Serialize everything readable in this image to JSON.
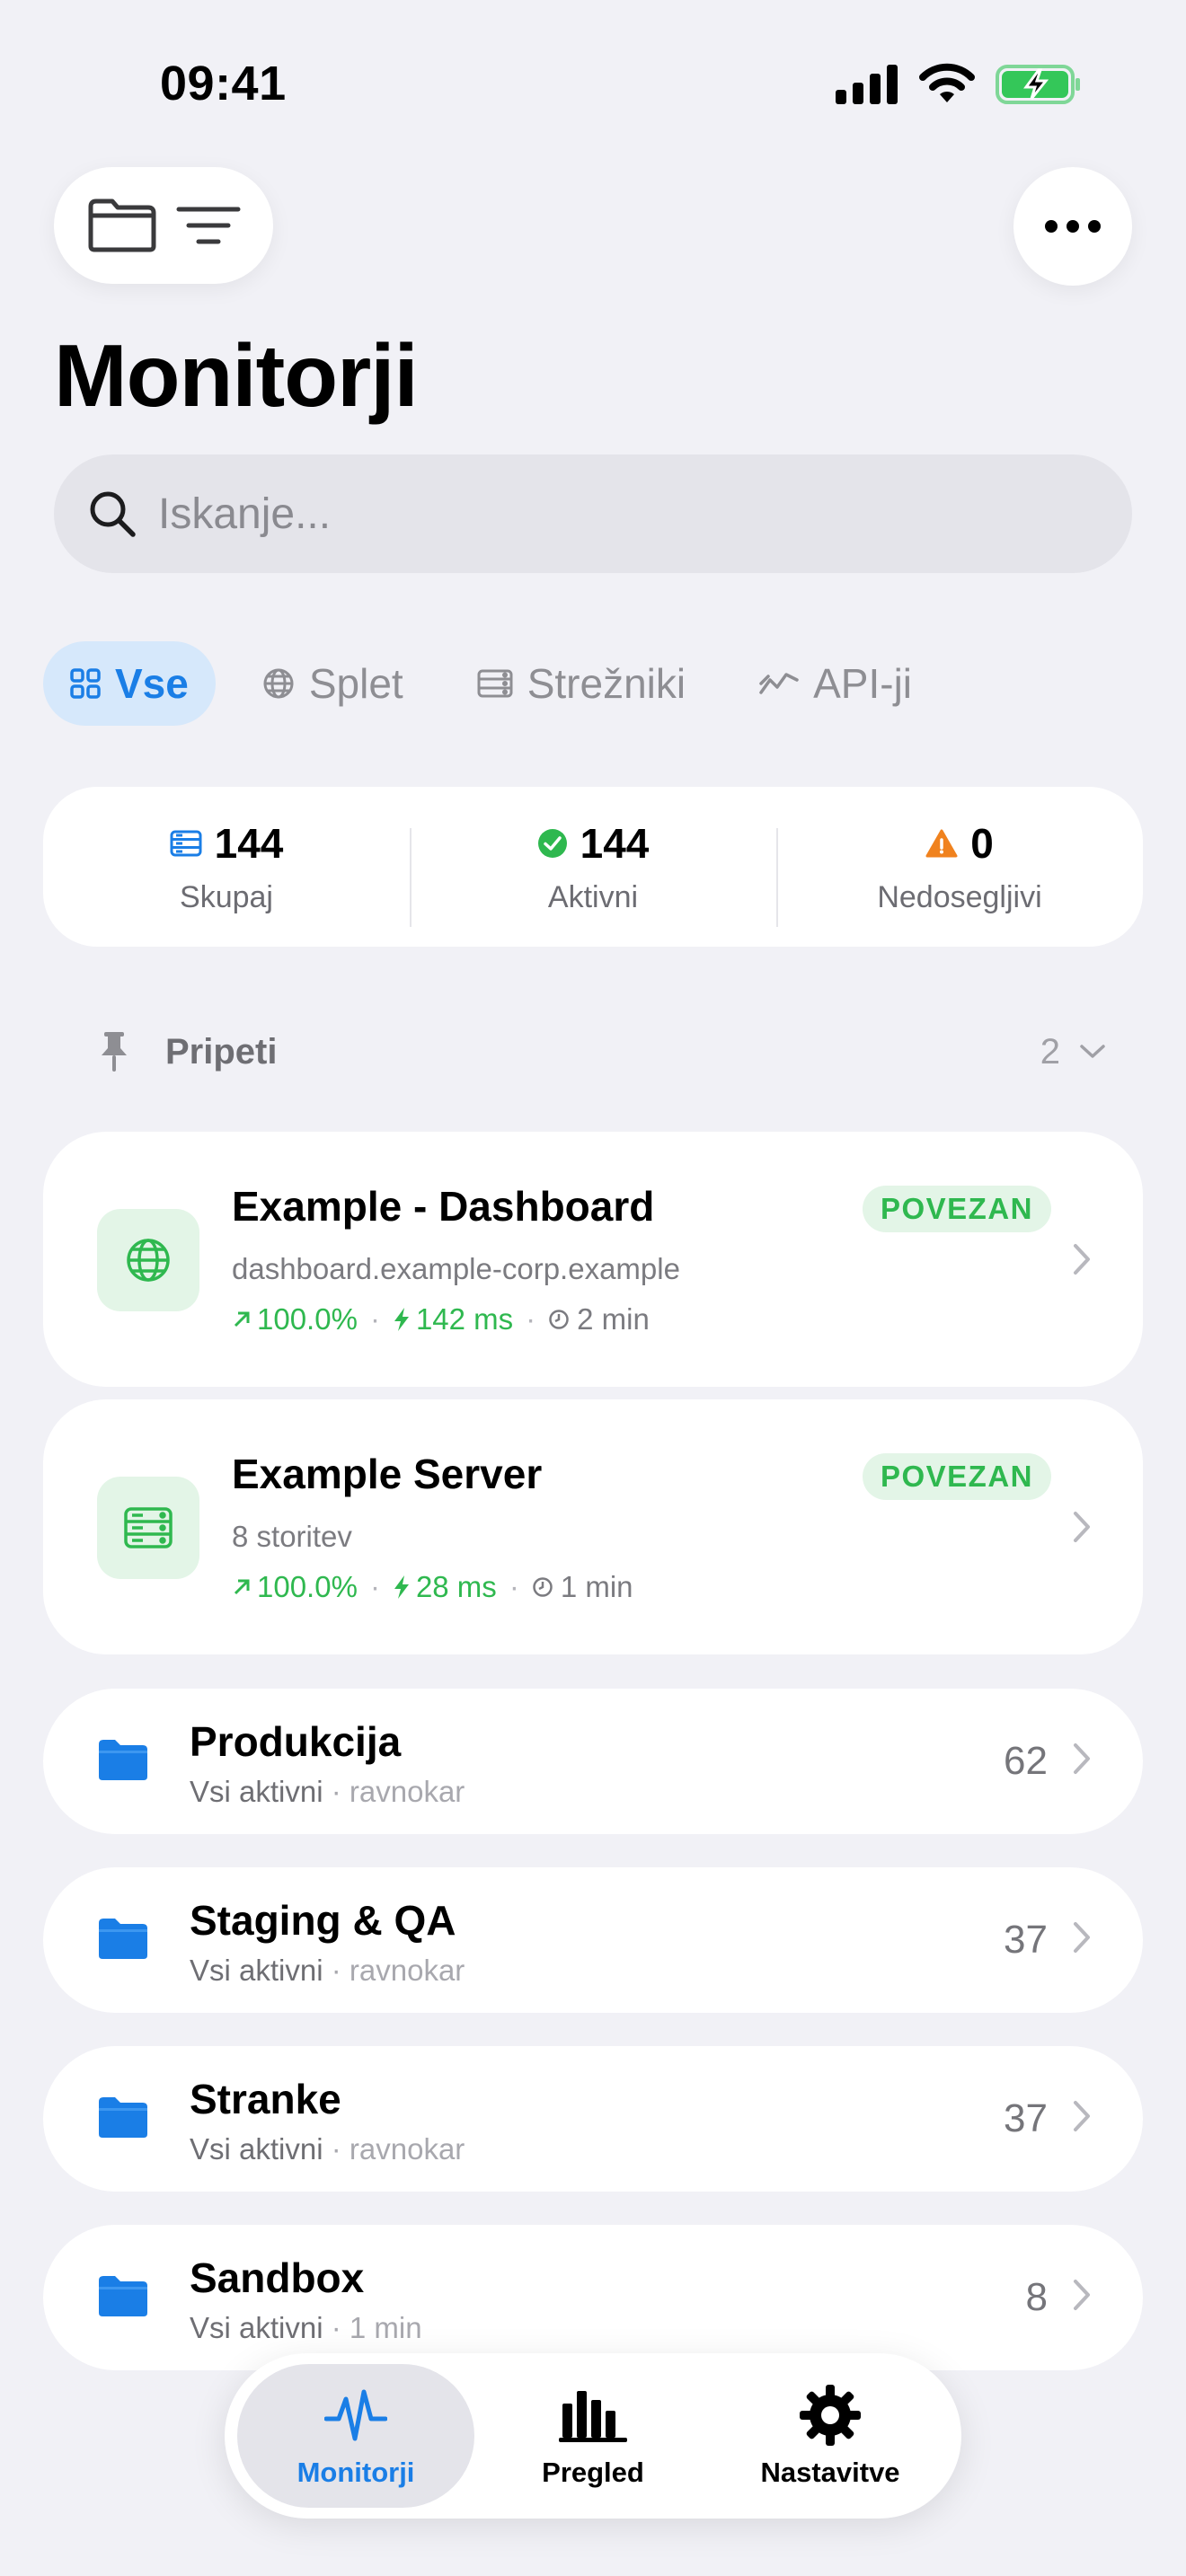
{
  "status_bar": {
    "time": "09:41"
  },
  "header": {
    "title": "Monitorji"
  },
  "search": {
    "placeholder": "Iskanje..."
  },
  "filters": [
    {
      "label": "Vse",
      "icon": "grid-icon",
      "active": true
    },
    {
      "label": "Splet",
      "icon": "globe-icon",
      "active": false
    },
    {
      "label": "Strežniki",
      "icon": "server-icon",
      "active": false
    },
    {
      "label": "API-ji",
      "icon": "api-wave-icon",
      "active": false
    }
  ],
  "stats": {
    "total": {
      "value": "144",
      "label": "Skupaj"
    },
    "active": {
      "value": "144",
      "label": "Aktivni"
    },
    "unreachable": {
      "value": "0",
      "label": "Nedosegljivi"
    }
  },
  "pinned": {
    "label": "Pripeti",
    "count": "2"
  },
  "monitors": [
    {
      "name": "Example - Dashboard",
      "subtitle": "dashboard.example-corp.example",
      "status": "POVEZAN",
      "uptime": "100.0%",
      "latency": "142 ms",
      "interval": "2 min",
      "icon": "globe-icon"
    },
    {
      "name": "Example Server",
      "subtitle": "8 storitev",
      "status": "POVEZAN",
      "uptime": "100.0%",
      "latency": "28 ms",
      "interval": "1 min",
      "icon": "server-icon"
    }
  ],
  "groups": [
    {
      "name": "Produkcija",
      "status": "Vsi aktivni",
      "time": "ravnokar",
      "count": "62"
    },
    {
      "name": "Staging & QA",
      "status": "Vsi aktivni",
      "time": "ravnokar",
      "count": "37"
    },
    {
      "name": "Stranke",
      "status": "Vsi aktivni",
      "time": "ravnokar",
      "count": "37"
    },
    {
      "name": "Sandbox",
      "status": "Vsi aktivni",
      "time": "1 min",
      "count": "8"
    }
  ],
  "tabbar": [
    {
      "label": "Monitorji",
      "icon": "pulse-icon",
      "active": true
    },
    {
      "label": "Pregled",
      "icon": "bar-chart-icon",
      "active": false
    },
    {
      "label": "Nastavitve",
      "icon": "gear-icon",
      "active": false
    }
  ],
  "colors": {
    "accent": "#1a7ee6",
    "success": "#2fb84f",
    "warning": "#f0821e",
    "background": "#f1f1f6"
  }
}
